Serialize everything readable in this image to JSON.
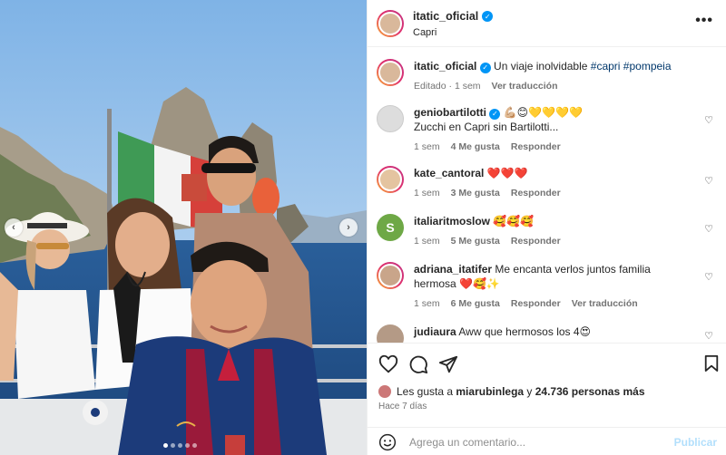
{
  "post": {
    "photo_nav": {
      "prev": "‹",
      "next": "›",
      "dots": 5,
      "active_dot": 0
    }
  },
  "header": {
    "username": "itatic_oficial",
    "location": "Capri",
    "more": "•••"
  },
  "caption": {
    "username": "itatic_oficial",
    "text": "Un viaje inolvidable ",
    "hashtags": "#capri #pompeia",
    "meta_edited": "Editado · 1 sem",
    "meta_translate": "Ver traducción"
  },
  "comments": [
    {
      "username": "geniobartilotti",
      "verified": true,
      "emoji_suffix": "💪🏼😊💛💛💛💛",
      "text": "Zucchi en Capri sin Bartilotti...",
      "time": "1 sem",
      "likes": "4 Me gusta",
      "reply": "Responder",
      "translate": ""
    },
    {
      "username": "kate_cantoral",
      "verified": false,
      "text": "❤️❤️❤️",
      "time": "1 sem",
      "likes": "3 Me gusta",
      "reply": "Responder",
      "translate": ""
    },
    {
      "username": "italiaritmoslow",
      "verified": false,
      "text": "🥰🥰🥰",
      "time": "1 sem",
      "likes": "5 Me gusta",
      "reply": "Responder",
      "translate": ""
    },
    {
      "username": "adriana_itatifer",
      "verified": false,
      "text": "Me encanta verlos juntos familia hermosa ❤️🥰✨",
      "time": "1 sem",
      "likes": "6 Me gusta",
      "reply": "Responder",
      "translate": "Ver traducción"
    },
    {
      "username": "judiaura",
      "verified": false,
      "text": "Aww que hermosos los 4😍",
      "time": "",
      "likes": "",
      "reply": "",
      "translate": ""
    }
  ],
  "likes_line": {
    "prefix": "Les gusta a ",
    "user": "miarubinlega",
    "middle": " y ",
    "count": "24.736 personas más"
  },
  "ago": "Hace 7 días",
  "comment_box": {
    "placeholder": "Agrega un comentario...",
    "publish": "Publicar"
  },
  "colors": {
    "accent": "#0095f6",
    "link": "#00376b",
    "muted": "#737373"
  }
}
